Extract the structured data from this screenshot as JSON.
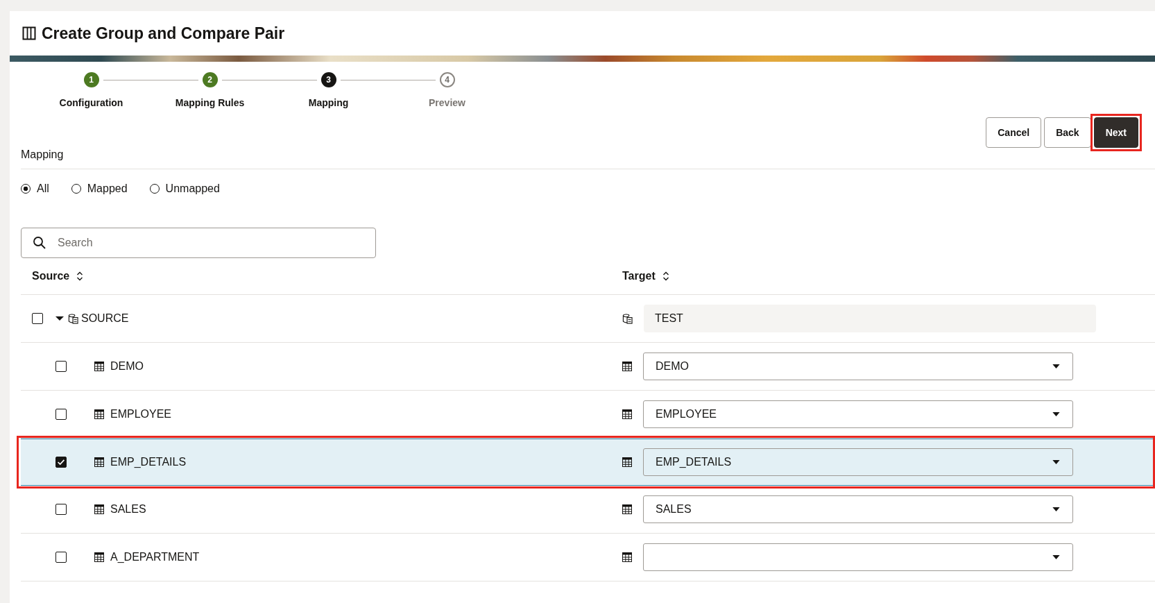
{
  "header": {
    "title": "Create Group and Compare Pair"
  },
  "steps": [
    {
      "number": "1",
      "label": "Configuration",
      "kind": "done"
    },
    {
      "number": "2",
      "label": "Mapping Rules",
      "kind": "done"
    },
    {
      "number": "3",
      "label": "Mapping",
      "kind": "current"
    },
    {
      "number": "4",
      "label": "Preview",
      "kind": "pending"
    }
  ],
  "buttons": [
    {
      "label": "Cancel",
      "kind": "secondary",
      "highlighted": false
    },
    {
      "label": "Back",
      "kind": "secondary",
      "highlighted": false
    },
    {
      "label": "Next",
      "kind": "primary",
      "highlighted": true
    }
  ],
  "section_label": "Mapping",
  "filters": [
    {
      "label": "All",
      "selected": true
    },
    {
      "label": "Mapped",
      "selected": false
    },
    {
      "label": "Unmapped",
      "selected": false
    }
  ],
  "search": {
    "placeholder": "Search"
  },
  "table": {
    "columns": [
      {
        "label": "Source"
      },
      {
        "label": "Target"
      }
    ],
    "root": {
      "source": "SOURCE",
      "checked": false,
      "expanded": true,
      "target": "TEST",
      "children": [
        {
          "source": "DEMO",
          "checked": false,
          "selected": false,
          "highlighted": false,
          "target": "DEMO"
        },
        {
          "source": "EMPLOYEE",
          "checked": false,
          "selected": false,
          "highlighted": false,
          "target": "EMPLOYEE"
        },
        {
          "source": "EMP_DETAILS",
          "checked": true,
          "selected": true,
          "highlighted": true,
          "target": "EMP_DETAILS"
        },
        {
          "source": "SALES",
          "checked": false,
          "selected": false,
          "highlighted": false,
          "target": "SALES"
        },
        {
          "source": "A_DEPARTMENT",
          "checked": false,
          "selected": false,
          "highlighted": false
        }
      ]
    }
  }
}
